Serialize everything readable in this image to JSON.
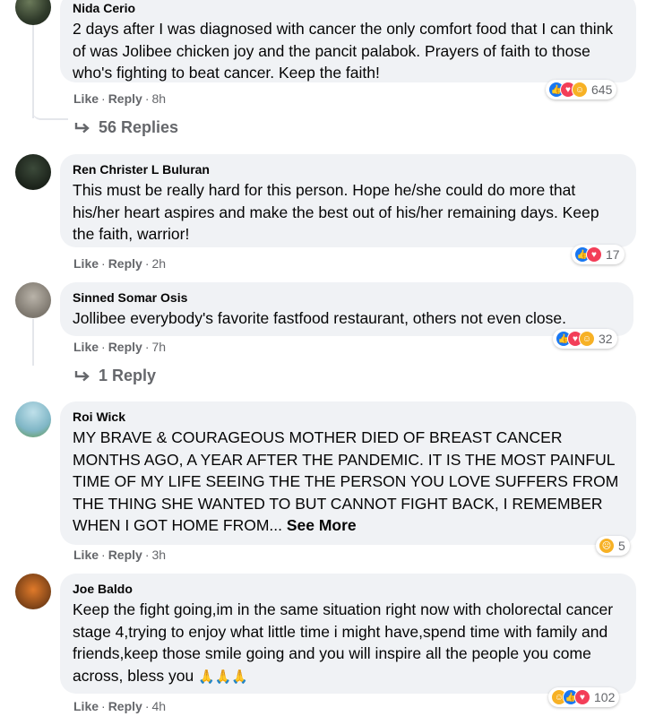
{
  "comments": [
    {
      "author": "Nida Cerio",
      "text": "2 days after I was diagnosed with cancer the only comfort food that I can think of was Jolibee chicken joy and the pancit palabok. Prayers of faith to those who's fighting to beat cancer. Keep the faith!",
      "like_label": "Like",
      "reply_label": "Reply",
      "time": "8h",
      "reaction_types": [
        "like",
        "love",
        "care"
      ],
      "reaction_count": "645",
      "replies_label": "56 Replies"
    },
    {
      "author": "Ren Christer L Buluran",
      "text": "This must be really hard for this person. Hope he/she could do more that his/her heart aspires and make the best out of his/her remaining days. Keep the faith, warrior!",
      "like_label": "Like",
      "reply_label": "Reply",
      "time": "2h",
      "reaction_types": [
        "like",
        "love"
      ],
      "reaction_count": "17"
    },
    {
      "author": "Sinned Somar Osis",
      "text": "Jollibee everybody's favorite fastfood restaurant, others not even close.",
      "like_label": "Like",
      "reply_label": "Reply",
      "time": "7h",
      "reaction_types": [
        "like",
        "love",
        "care"
      ],
      "reaction_count": "32",
      "replies_label": "1 Reply"
    },
    {
      "author": "Roi Wick",
      "text": "MY BRAVE & COURAGEOUS MOTHER DIED OF BREAST CANCER MONTHS AGO, A YEAR AFTER THE PANDEMIC. IT IS THE MOST PAINFUL TIME OF MY LIFE SEEING THE THE PERSON YOU LOVE SUFFERS FROM THE THING SHE WANTED TO BUT CANNOT FIGHT BACK, I REMEMBER WHEN I GOT HOME FROM...",
      "see_more": "See More",
      "like_label": "Like",
      "reply_label": "Reply",
      "time": "3h",
      "reaction_types": [
        "sad"
      ],
      "reaction_count": "5"
    },
    {
      "author": "Joe Baldo",
      "text": "Keep the fight going,im in the same situation right now with cholorectal cancer stage 4,trying to enjoy what little time i might have,spend time with family and friends,keep those smile going and you will inspire all the people you come across, bless you",
      "emoji": "🙏🙏🙏",
      "like_label": "Like",
      "reply_label": "Reply",
      "time": "4h",
      "reaction_types": [
        "care",
        "like",
        "love"
      ],
      "reaction_count": "102"
    }
  ],
  "colors": {
    "bubble": "#f0f2f5",
    "meta": "#65676b",
    "like": "#1877f2",
    "love": "#f33e58",
    "care": "#f7b125"
  }
}
